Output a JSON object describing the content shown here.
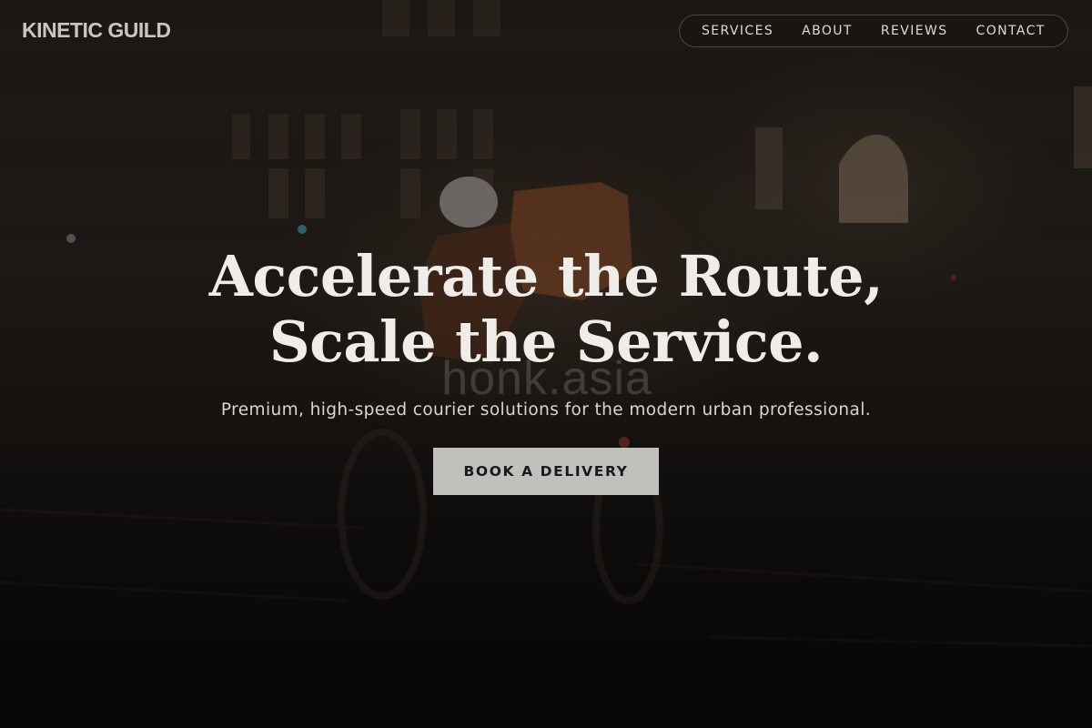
{
  "brand": {
    "name": "KINETIC GUILD"
  },
  "nav": {
    "items": [
      {
        "label": "SERVICES"
      },
      {
        "label": "ABOUT"
      },
      {
        "label": "REVIEWS"
      },
      {
        "label": "CONTACT"
      }
    ]
  },
  "hero": {
    "headline_line1": "Accelerate the Route,",
    "headline_line2": "Scale the Service.",
    "subheadline": "Premium, high-speed courier solutions for the modern urban professional.",
    "cta_label": "BOOK A DELIVERY",
    "background_image": "night street with courier cyclist carrying orange delivery backpack",
    "watermark": "honk.asia"
  },
  "colors": {
    "background": "#0e0c0b",
    "headline": "#efedea",
    "cta_background": "#c2c0bd",
    "cta_text": "#1b1917",
    "nav_border": "rgba(255,255,255,0.22)"
  }
}
